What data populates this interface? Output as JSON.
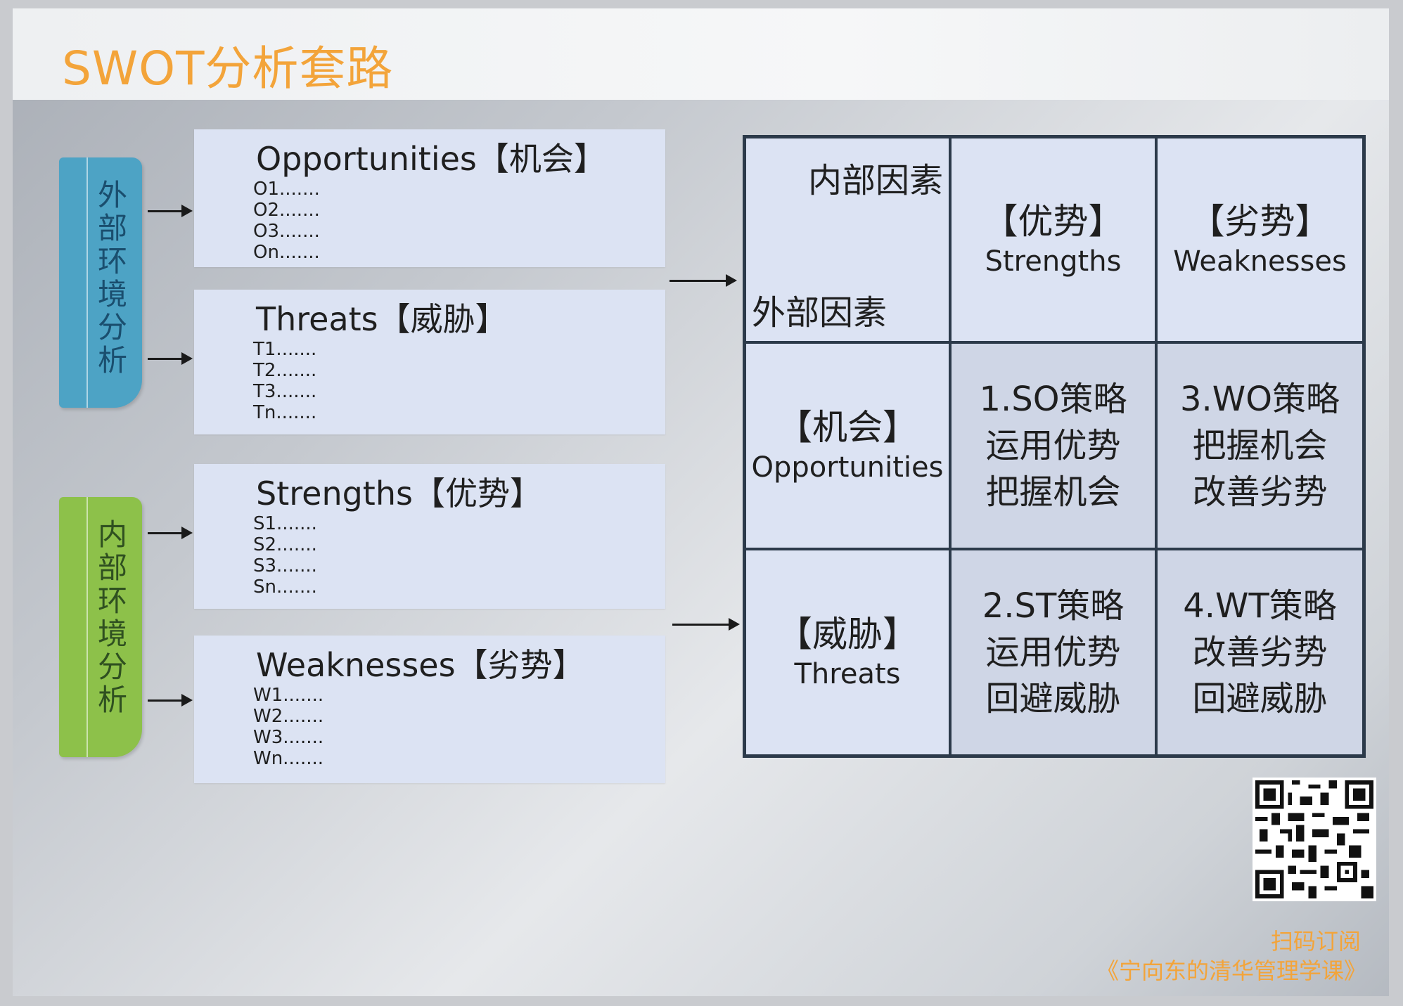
{
  "title": "SWOT分析套路",
  "external_label": [
    "外",
    "部",
    "环",
    "境",
    "分",
    "析"
  ],
  "internal_label": [
    "内",
    "部",
    "环",
    "境",
    "分",
    "析"
  ],
  "boxes": [
    {
      "head": "Opportunities【机会】",
      "items": [
        "O1.......",
        "O2.......",
        "O3.......",
        "On......."
      ]
    },
    {
      "head": "Threats【威胁】",
      "items": [
        "T1.......",
        "T2.......",
        "T3.......",
        "Tn......."
      ]
    },
    {
      "head": "Strengths【优势】",
      "items": [
        "S1.......",
        "S2.......",
        "S3.......",
        "Sn......."
      ]
    },
    {
      "head": "Weaknesses【劣势】",
      "items": [
        "W1.......",
        "W2.......",
        "W3.......",
        "Wn......."
      ]
    }
  ],
  "matrix": {
    "corner_top": "内部因素",
    "corner_bottom": "外部因素",
    "col_headers": [
      {
        "cn": "【优势】",
        "en": "Strengths"
      },
      {
        "cn": "【劣势】",
        "en": "Weaknesses"
      }
    ],
    "row_headers": [
      {
        "cn": "【机会】",
        "en": "Opportunities"
      },
      {
        "cn": "【威胁】",
        "en": "Threats"
      }
    ],
    "cells": [
      [
        [
          "1.SO策略",
          "运用优势",
          "把握机会"
        ],
        [
          "3.WO策略",
          "把握机会",
          "改善劣势"
        ]
      ],
      [
        [
          "2.ST策略",
          "运用优势",
          "回避威胁"
        ],
        [
          "4.WT策略",
          "改善劣势",
          "回避威胁"
        ]
      ]
    ]
  },
  "caption": {
    "line1": "扫码订阅",
    "line2": "《宁向东的清华管理学课》"
  },
  "colors": {
    "title": "#f3a43a",
    "external": "#4da3c5",
    "internal": "#8dc14a",
    "box": "#dce3f3",
    "border": "#2c3a4a"
  }
}
